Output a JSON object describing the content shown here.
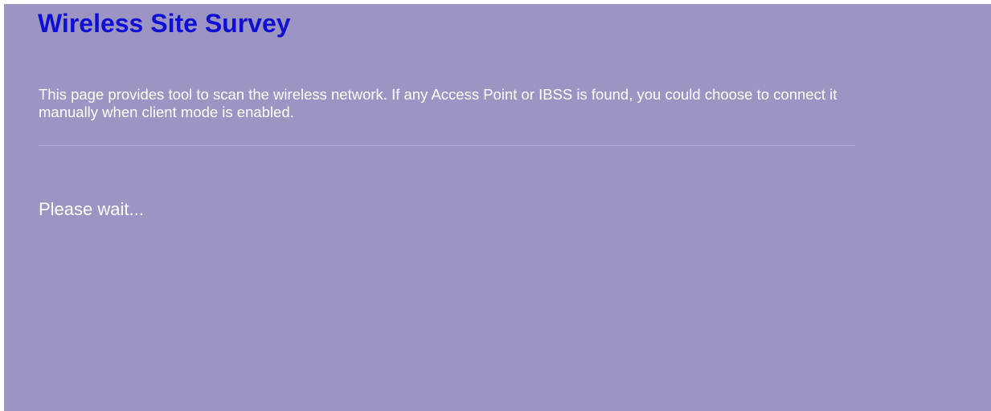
{
  "page": {
    "title": "Wireless Site Survey",
    "description": "This page provides tool to scan the wireless network. If any Access Point or IBSS is found, you could choose to connect it manually when client mode is enabled.",
    "status": "Please wait..."
  },
  "colors": {
    "background": "#9c94c2",
    "title": "#0f0fd4",
    "text": "#ffffff",
    "divider": "#b2acd0"
  }
}
